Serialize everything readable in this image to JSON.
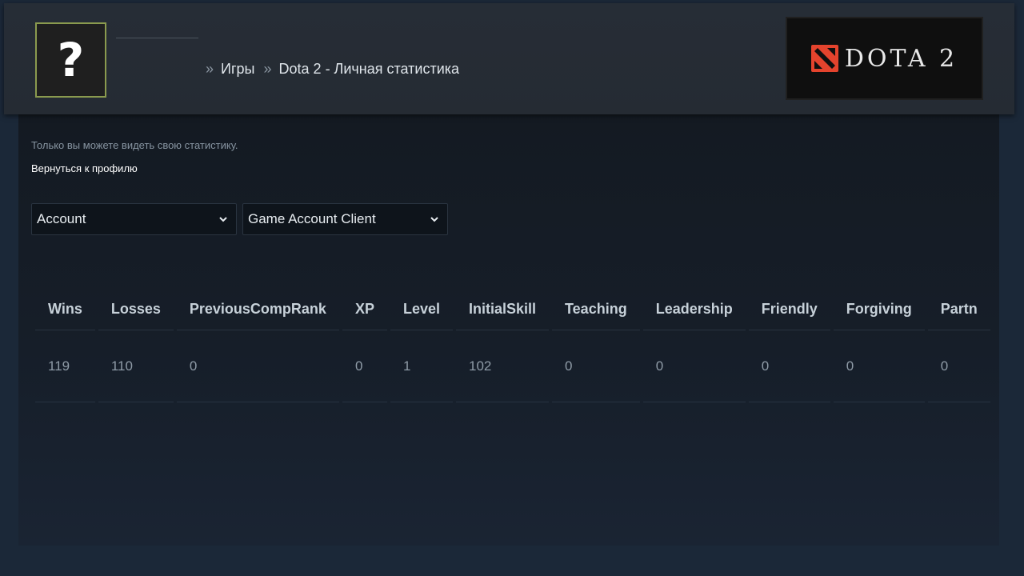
{
  "header": {
    "avatar_glyph": "?",
    "breadcrumb": [
      {
        "label": "Игры"
      },
      {
        "label": "Dota 2 - Личная статистика"
      }
    ],
    "breadcrumb_separator": "»",
    "game_logo": {
      "text": "DOTA 2",
      "icon": "dota2-emblem-icon",
      "emblem_color": "#e4432d"
    }
  },
  "main": {
    "privacy_note": "Только вы можете видеть свою статистику.",
    "back_link": "Вернуться к профилю",
    "selects": {
      "category": {
        "selected": "Account"
      },
      "subcategory": {
        "selected": "Game Account Client"
      }
    },
    "stats": {
      "columns": [
        "Wins",
        "Losses",
        "PreviousCompRank",
        "XP",
        "Level",
        "InitialSkill",
        "Teaching",
        "Leadership",
        "Friendly",
        "Forgiving",
        "Partn"
      ],
      "rows": [
        [
          "119",
          "110",
          "0",
          "0",
          "1",
          "102",
          "0",
          "0",
          "0",
          "0",
          "0"
        ]
      ]
    }
  },
  "colors": {
    "background": "#1b2838",
    "header": "#262d36",
    "avatar_border": "#8a9a4e",
    "accent": "#e4432d"
  }
}
